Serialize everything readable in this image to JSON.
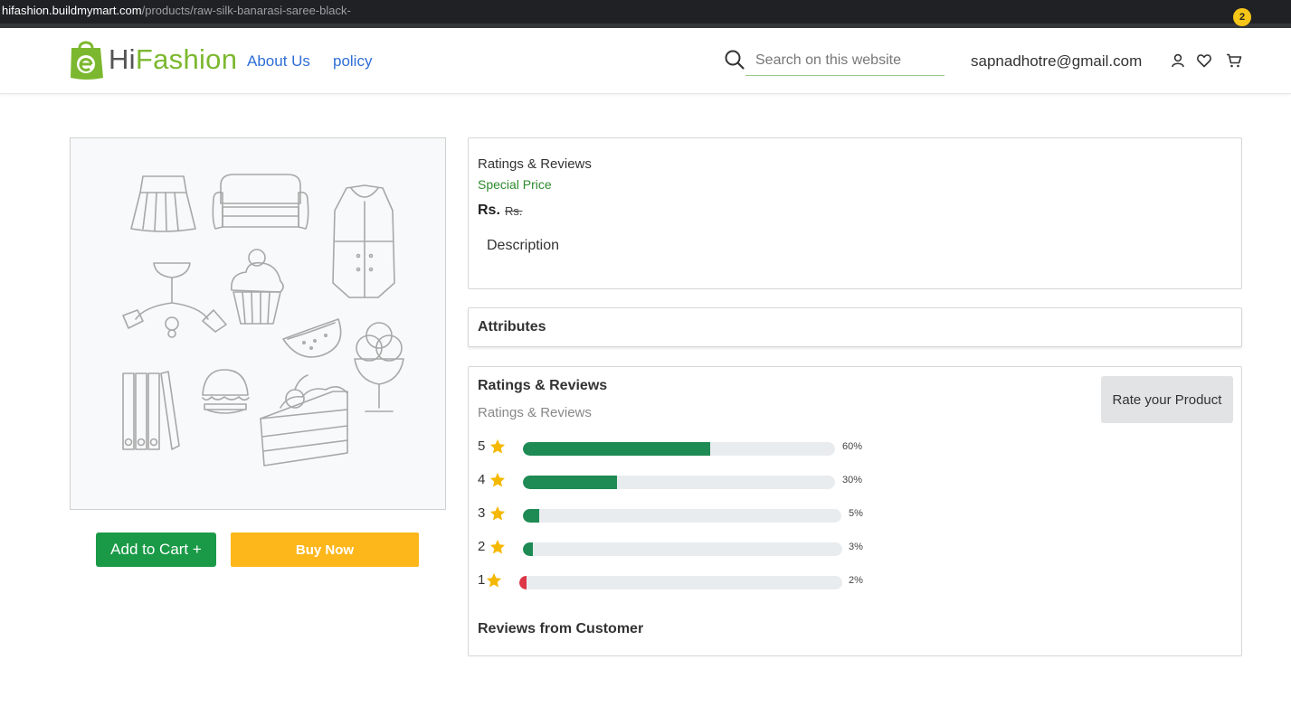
{
  "browser": {
    "url_host": "hifashion.buildmymart.com",
    "url_path": "/products/raw-silk-banarasi-saree-black-"
  },
  "header": {
    "logo_prefix": "Hi",
    "logo_accent": "Fashion",
    "nav": [
      "About Us",
      "policy"
    ],
    "search_placeholder": "Search on this website",
    "user_email": "sapnadhotre@gmail.com",
    "cart_count": "2",
    "icons": [
      "search-icon",
      "user-icon",
      "heart-icon",
      "cart-icon"
    ]
  },
  "product": {
    "add_to_cart_label": "Add to Cart +",
    "buy_now_label": "Buy Now"
  },
  "details": {
    "heading": "Ratings & Reviews",
    "special_price": "Special Price",
    "price_prefix": "Rs.",
    "original_price": "Rs.",
    "description_label": "Description",
    "attributes_label": "Attributes"
  },
  "ratings": {
    "title": "Ratings & Reviews",
    "subtitle": "Ratings & Reviews",
    "rate_button": "Rate your Product",
    "rows": [
      {
        "stars": "5",
        "percent": 60,
        "label": "60%"
      },
      {
        "stars": "4",
        "percent": 30,
        "label": "30%"
      },
      {
        "stars": "3",
        "percent": 5,
        "label": "5%"
      },
      {
        "stars": "2",
        "percent": 3,
        "label": "3%"
      },
      {
        "stars": "1",
        "percent": 2,
        "label": "2%"
      }
    ],
    "reviews_heading": "Reviews from Customer"
  },
  "colors": {
    "brand_green": "#7cb82f",
    "link_blue": "#2f6fd6",
    "cart_button": "#1a9a47",
    "buy_button": "#fdb71b",
    "bar_green": "#1e8a54",
    "bar_red": "#dc3545",
    "star": "#f5b800",
    "price_green": "#2e8b2e"
  }
}
